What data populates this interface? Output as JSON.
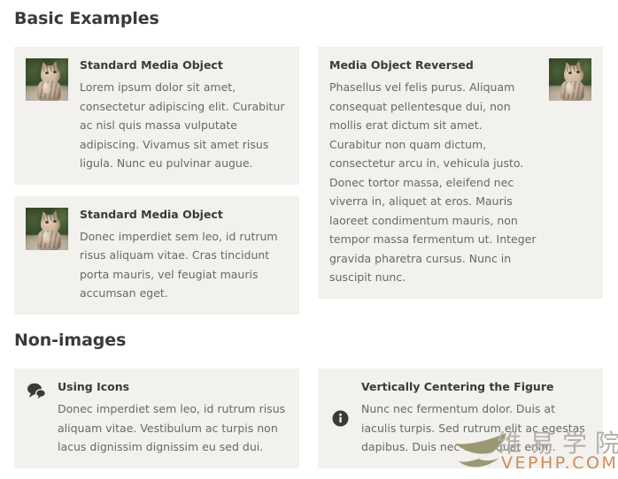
{
  "page": {
    "background_color": "#ffffff",
    "card_background_color": "#f2f1ed",
    "heading_color": "#3a3a38",
    "body_text_color": "#696964"
  },
  "sections": [
    {
      "heading": "Basic Examples",
      "left_column": [
        {
          "type": "media",
          "image_alt": "kitten-photo",
          "title": "Standard Media Object",
          "text": "Lorem ipsum dolor sit amet, consectetur adipiscing elit. Curabitur ac nisl quis massa vulputate adipiscing. Vivamus sit amet risus ligula. Nunc eu pulvinar augue."
        },
        {
          "type": "media",
          "image_alt": "kitten-photo",
          "title": "Standard Media Object",
          "text": "Donec imperdiet sem leo, id rutrum risus aliquam vitae. Cras tincidunt porta mauris, vel feugiat mauris accumsan eget."
        }
      ],
      "right_column": [
        {
          "type": "media-reversed",
          "image_alt": "kitten-photo",
          "title": "Media Object Reversed",
          "text": "Phasellus vel felis purus. Aliquam consequat pellentesque dui, non mollis erat dictum sit amet. Curabitur non quam dictum, consectetur arcu in, vehicula justo. Donec tortor massa, eleifend nec viverra in, aliquet at eros. Mauris laoreet condimentum mauris, non tempor massa fermentum ut. Integer gravida pharetra cursus. Nunc in suscipit nunc."
        }
      ]
    },
    {
      "heading": "Non-images",
      "left_column": [
        {
          "type": "icon",
          "icon": "comments-icon",
          "title": "Using Icons",
          "text": "Donec imperdiet sem leo, id rutrum risus aliquam vitae. Vestibulum ac turpis non lacus dignissim dignissim eu sed dui."
        }
      ],
      "right_column": [
        {
          "type": "icon-centered",
          "icon": "info-circle-icon",
          "title": "Vertically Centering the Figure",
          "text": "Nunc nec fermentum dolor. Duis at iaculis turpis. Sed rutrum elit ac egestas dapibus. Duis nec consequat enim."
        }
      ]
    }
  ],
  "watermark": {
    "chinese_text": "维易学院",
    "domain_text": "VEPHP.COM",
    "swoosh_color": "#9b9873",
    "chinese_color": "#b3b0aa",
    "domain_color": "#cf8c5a"
  }
}
